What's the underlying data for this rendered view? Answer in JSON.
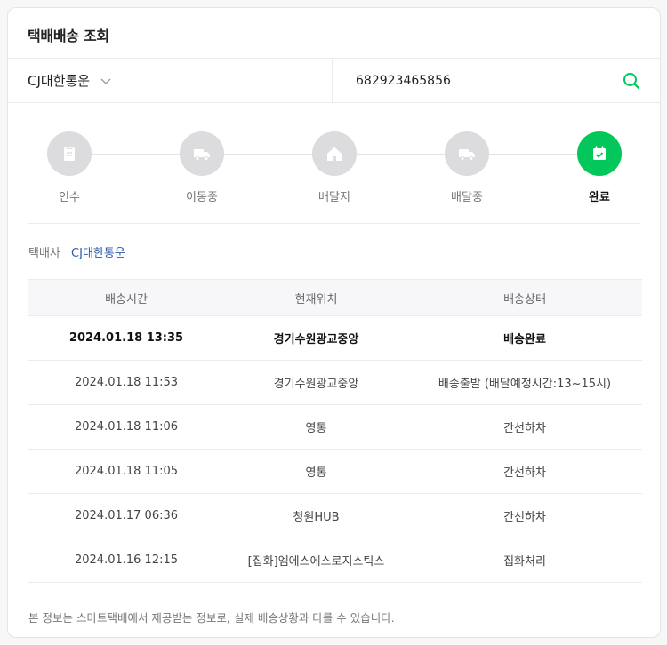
{
  "title": "택배배송 조회",
  "search": {
    "carrier": "CJ대한통운",
    "tracking_number": "682923465856",
    "accent": "#03c75a"
  },
  "steps": [
    {
      "label": "인수",
      "icon": "receipt-icon",
      "active": false
    },
    {
      "label": "이동중",
      "icon": "truck-icon",
      "active": false
    },
    {
      "label": "배달지",
      "icon": "house-icon",
      "active": false
    },
    {
      "label": "배달중",
      "icon": "delivery-truck-icon",
      "active": false
    },
    {
      "label": "완료",
      "icon": "check-calendar-icon",
      "active": true
    }
  ],
  "carrier_info": {
    "label": "택배사",
    "value": "CJ대한통운"
  },
  "table": {
    "headers": [
      "배송시간",
      "현재위치",
      "배송상태"
    ],
    "rows": [
      [
        "2024.01.18 13:35",
        "경기수원광교중앙",
        "배송완료"
      ],
      [
        "2024.01.18 11:53",
        "경기수원광교중앙",
        "배송출발 (배달예정시간:13~15시)"
      ],
      [
        "2024.01.18 11:06",
        "영통",
        "간선하차"
      ],
      [
        "2024.01.18 11:05",
        "영통",
        "간선하차"
      ],
      [
        "2024.01.17 06:36",
        "청원HUB",
        "간선하차"
      ],
      [
        "2024.01.16 12:15",
        "[집화]엠에스에스로지스틱스",
        "집화처리"
      ]
    ]
  },
  "notice": "본 정보는 스마트택배에서 제공받는 정보로, 실제 배송상황과 다를 수 있습니다."
}
